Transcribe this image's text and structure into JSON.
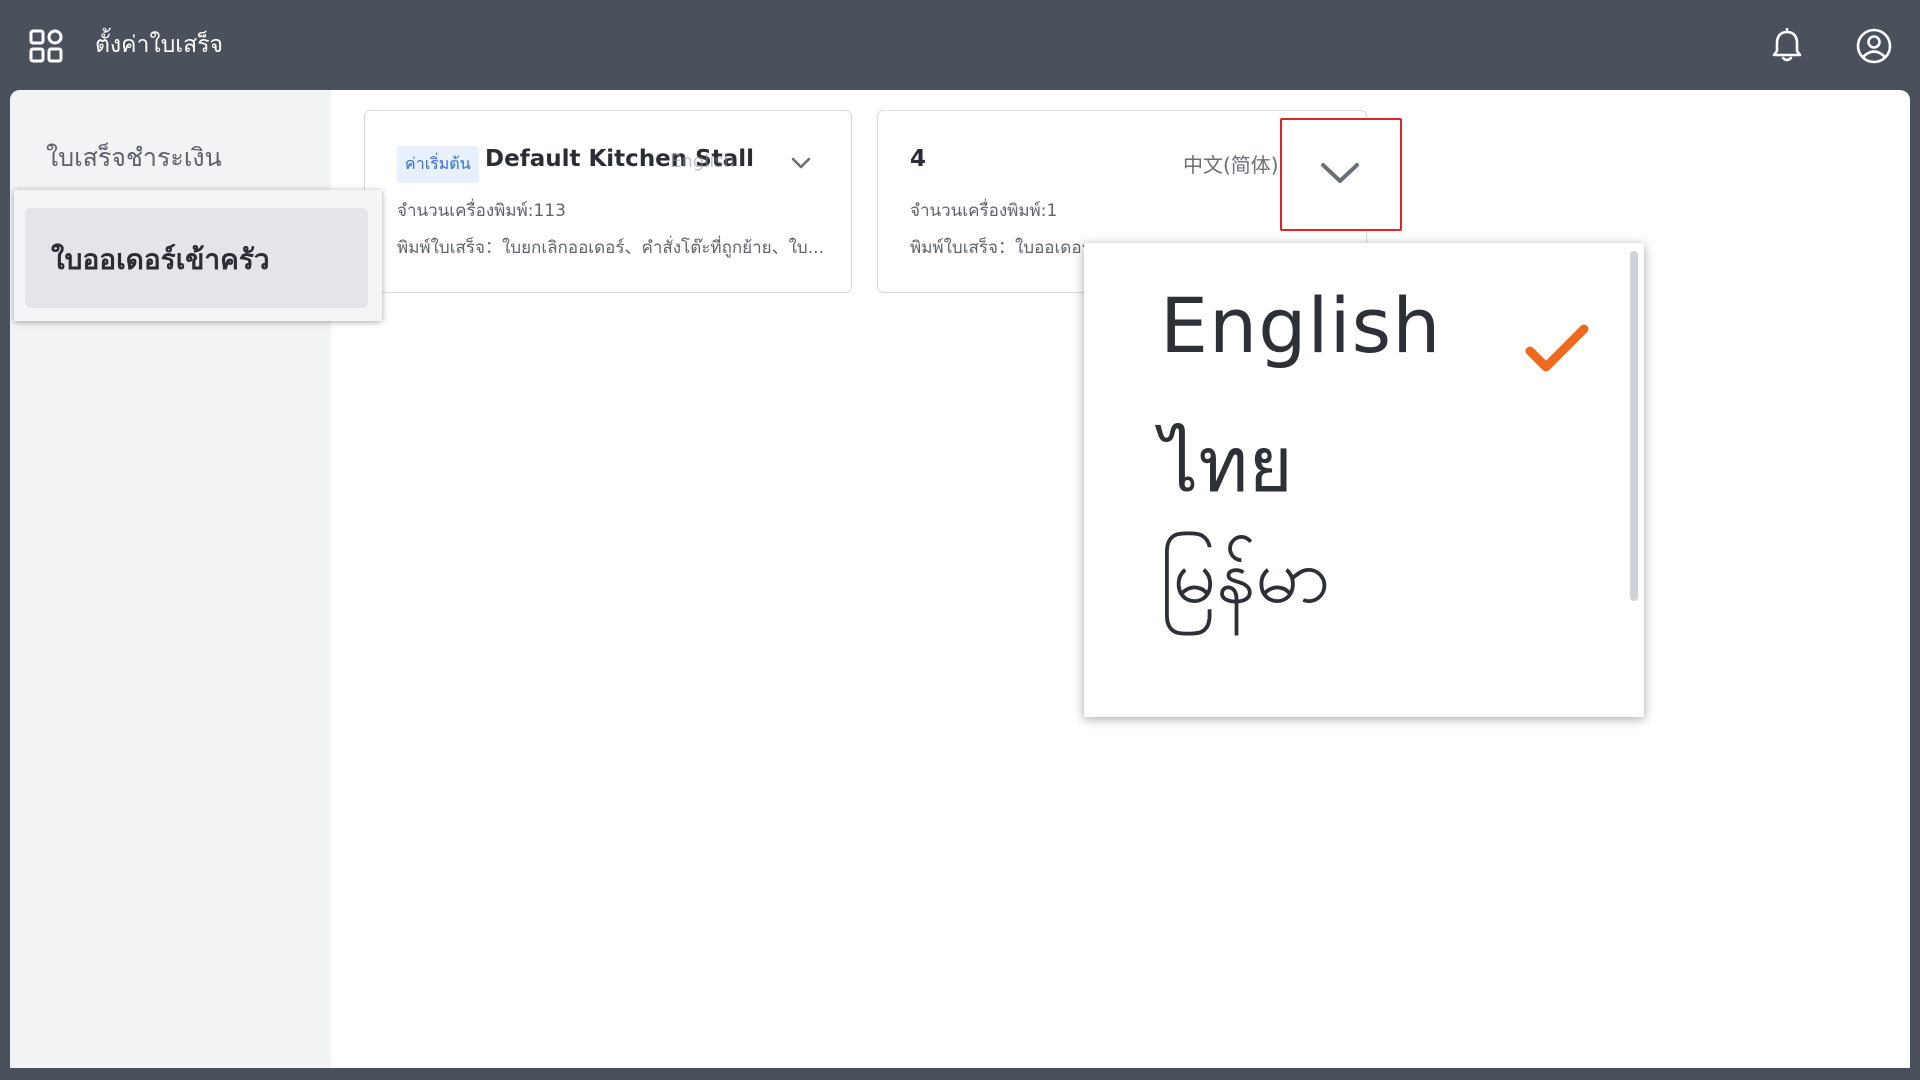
{
  "header": {
    "title": "ตั้งค่าใบเสร็จ"
  },
  "sidebar": {
    "items": [
      {
        "label": "ใบเสร็จชำระเงิน"
      },
      {
        "label": "ใบออเดอร์เข้าครัว"
      }
    ]
  },
  "cards": [
    {
      "tag": "ค่าเริ่มต้น",
      "title": "Default Kitchen Stall",
      "language": "English",
      "printer_count": "จำนวนเครื่องพิมพ์:113",
      "print_receipts": "พิมพ์ใบเสร็จ：ใบยกเลิกออเดอร์、คำสั่งโต๊ะที่ถูกย้าย、ใบ..."
    },
    {
      "title": "4",
      "language": "中文(简体)",
      "printer_count": "จำนวนเครื่องพิมพ์:1",
      "print_receipts": "พิมพ์ใบเสร็จ：ใบออเดอร์..."
    }
  ],
  "language_dropdown": {
    "options": [
      {
        "label": "English",
        "selected": true
      },
      {
        "label": "ไทย",
        "selected": false
      },
      {
        "label": "မြန်မာ",
        "selected": false
      }
    ],
    "check_color": "#f06a1d"
  },
  "colors": {
    "topbar": "#4b515c",
    "tag_bg": "#e8f0fd",
    "tag_text": "#2f6fd8",
    "highlight": "#e02424"
  }
}
